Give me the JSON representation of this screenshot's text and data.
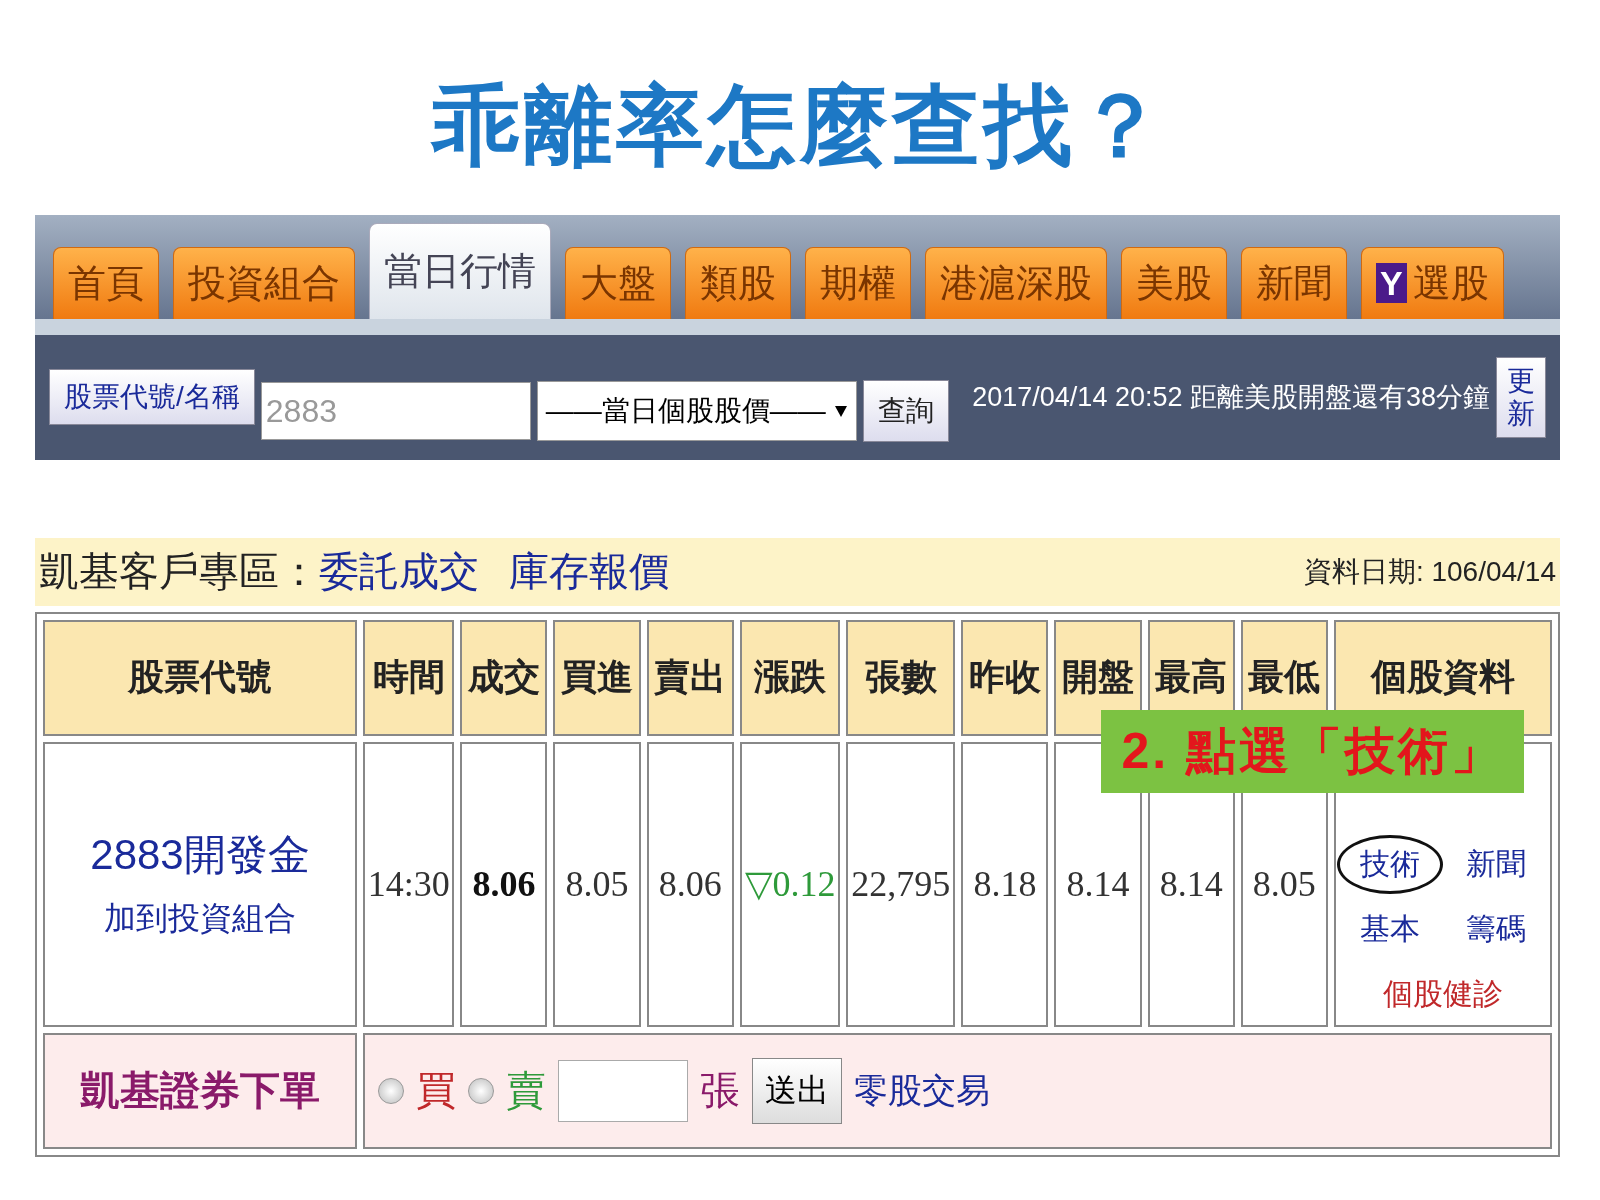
{
  "title": "乖離率怎麼查找？",
  "nav": {
    "tabs": [
      {
        "label": "首頁",
        "selected": false
      },
      {
        "label": "投資組合",
        "selected": false
      },
      {
        "label": "當日行情",
        "selected": true
      },
      {
        "label": "大盤",
        "selected": false
      },
      {
        "label": "類股",
        "selected": false
      },
      {
        "label": "期權",
        "selected": false
      },
      {
        "label": "港滬深股",
        "selected": false
      },
      {
        "label": "美股",
        "selected": false
      },
      {
        "label": "新聞",
        "selected": false
      },
      {
        "label": "選股",
        "selected": false,
        "badge": "Y"
      }
    ],
    "search": {
      "label_button": "股票代號/名稱",
      "value": "2883",
      "dropdown": "——當日個股股價——",
      "query_button": "查詢",
      "status": "2017/04/14 20:52 距離美股開盤還有38分鐘",
      "refresh_button": "更新"
    }
  },
  "client": {
    "label": "凱基客戶專區：",
    "links": [
      "委託成交",
      "庫存報價"
    ],
    "date": "資料日期: 106/04/14"
  },
  "table": {
    "columns": [
      "股票代號",
      "時間",
      "成交",
      "買進",
      "賣出",
      "漲跌",
      "張數",
      "昨收",
      "開盤",
      "最高",
      "最低",
      "個股資料"
    ],
    "row": {
      "stock": "2883開發金",
      "add_link": "加到投資組合",
      "time": "14:30",
      "price": "8.06",
      "bid": "8.05",
      "ask": "8.06",
      "change": "▽0.12",
      "falling": true,
      "volume": "22,795",
      "prev_close": "8.18",
      "open": "8.14",
      "high": "8.14",
      "low": "8.05",
      "info_links": [
        {
          "label": "技術",
          "color": "#1a2a9a",
          "circled": true
        },
        {
          "label": "新聞",
          "color": "#1a2a9a",
          "circled": false
        },
        {
          "label": "基本",
          "color": "#1a2a9a",
          "circled": false
        },
        {
          "label": "籌碼",
          "color": "#1a2a9a",
          "circled": false
        },
        {
          "label": "個股健診",
          "color": "#c0282a",
          "circled": false
        }
      ]
    },
    "order": {
      "label": "凱基證券下單",
      "options": [
        {
          "label": "買",
          "selected": false,
          "color": "#c0282a"
        },
        {
          "label": "賣",
          "selected": false,
          "color": "#2e9a3a"
        }
      ],
      "unit": "張",
      "submit": "送出",
      "odd_lot_link": "零股交易"
    }
  },
  "callout": {
    "text": "2. 點選「技術」"
  }
}
